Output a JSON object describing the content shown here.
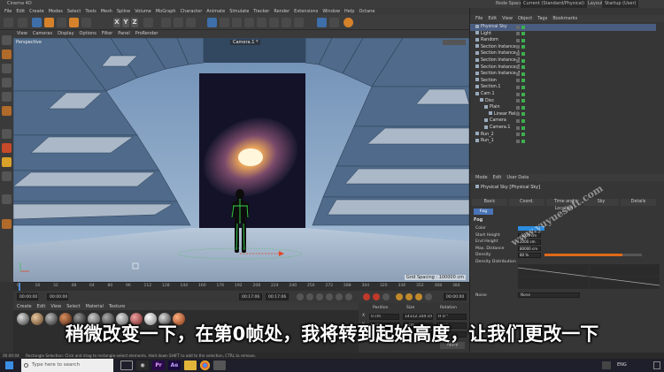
{
  "app": {
    "title": "Cinema 4D",
    "node_space_label": "Node Space:",
    "node_space_value": "Current (Standard/Physical)",
    "layout_label": "Layout:",
    "layout_value": "Startup (User)"
  },
  "menubar": [
    "File",
    "Edit",
    "Create",
    "Modes",
    "Select",
    "Tools",
    "Mesh",
    "Spline",
    "Volume",
    "MoGraph",
    "Character",
    "Animate",
    "Simulate",
    "Tracker",
    "Render",
    "Extensions",
    "Window",
    "Help",
    "Octane"
  ],
  "toolbar": {
    "axis_letters": [
      "X",
      "Y",
      "Z"
    ],
    "accent_blue": "#3e6fa8",
    "accent_orange": "#d6822b"
  },
  "viewport": {
    "menu": [
      "View",
      "Cameras",
      "Display",
      "Options",
      "Filter",
      "Panel",
      "ProRender"
    ],
    "projection_label": "Perspective",
    "camera_label": "Camera.1 *",
    "grid_spacing": "Grid Spacing : 100000 cm"
  },
  "timeline": {
    "ticks": [
      "0",
      "16",
      "32",
      "48",
      "64",
      "80",
      "96",
      "112",
      "128",
      "144",
      "160",
      "176",
      "192",
      "208",
      "224",
      "240",
      "256",
      "272",
      "288",
      "304",
      "320",
      "336",
      "352",
      "368",
      "384"
    ],
    "current_frame": "0 F",
    "start_field": "00:00:00",
    "min_field": "00:00:00",
    "end_field": "00:17:06",
    "max_field": "00:17:06",
    "right_field": "00:00:00"
  },
  "materials": {
    "menu": [
      "Create",
      "Edit",
      "View",
      "Select",
      "Material",
      "Texture"
    ]
  },
  "coordinates": {
    "headers": [
      "Position",
      "Size",
      "Rotation"
    ],
    "rows": [
      {
        "axis": "X",
        "pos": "0 cm",
        "size": "14312.104 cm",
        "rot": "H  0 °"
      },
      {
        "axis": "Y",
        "pos": "0 cm",
        "size": "0 cm",
        "rot": "P  0 °"
      },
      {
        "axis": "Z",
        "pos": "0 cm",
        "size": "0 cm",
        "rot": "B  0 °"
      }
    ],
    "apply_button": "Apply"
  },
  "object_manager": {
    "menu": [
      "File",
      "Edit",
      "View",
      "Object",
      "Tags",
      "Bookmarks"
    ],
    "objects": [
      {
        "name": "Physical Sky",
        "selected": true,
        "indent": 0
      },
      {
        "name": "Light",
        "selected": false,
        "indent": 0
      },
      {
        "name": "Random",
        "selected": false,
        "indent": 0
      },
      {
        "name": "Section Instance",
        "selected": false,
        "indent": 0
      },
      {
        "name": "Section Instance.1",
        "selected": false,
        "indent": 0
      },
      {
        "name": "Section Instance.2",
        "selected": false,
        "indent": 0
      },
      {
        "name": "Section Instance.3",
        "selected": false,
        "indent": 0
      },
      {
        "name": "Section Instance.4",
        "selected": false,
        "indent": 0
      },
      {
        "name": "Section",
        "selected": false,
        "indent": 0
      },
      {
        "name": "Section.1",
        "selected": false,
        "indent": 0
      },
      {
        "name": "Cam 1",
        "selected": false,
        "indent": 0
      },
      {
        "name": "Disc",
        "selected": false,
        "indent": 1
      },
      {
        "name": "Plain",
        "selected": false,
        "indent": 2
      },
      {
        "name": "Linear Field",
        "selected": false,
        "indent": 3
      },
      {
        "name": "Camera",
        "selected": false,
        "indent": 2
      },
      {
        "name": "Camera.1",
        "selected": false,
        "indent": 2
      },
      {
        "name": "Run_2",
        "selected": false,
        "indent": 0
      },
      {
        "name": "Run_1",
        "selected": false,
        "indent": 0
      }
    ]
  },
  "attribute_manager": {
    "menu": [
      "Mode",
      "Edit",
      "User Data"
    ],
    "object_title": "Physical Sky [Physical Sky]",
    "tabs": [
      "Basic",
      "Coord.",
      "Time and Location",
      "Sky",
      "Details"
    ],
    "active_subtab": "Fog",
    "section_title": "Fog",
    "fields": [
      {
        "label": "Color",
        "value": ""
      },
      {
        "label": "Start Height",
        "value": "-5000 cm"
      },
      {
        "label": "End Height",
        "value": "2000 cm"
      },
      {
        "label": "Max. Distance",
        "value": "80000 cm"
      },
      {
        "label": "Density",
        "value": "80 %"
      },
      {
        "label": "Density Distribution",
        "value": ""
      }
    ],
    "noise_label": "Noise",
    "noise_value": "None",
    "fog_color": "#2b8ce0",
    "density_marker_color": "#e06a1a"
  },
  "statusbar": {
    "time": "00:00:04",
    "message": "Rectangle Selection: Click and drag to rectangle-select elements. Hold down SHIFT to add to the selection, CTRL to remove."
  },
  "taskbar": {
    "search_placeholder": "Type here to search",
    "language": "ENG",
    "app_labels": [
      "Pr",
      "Ae"
    ]
  },
  "subtitle": "稍微改变一下，在第0帧处，我将转到起始高度，让我们更改一下",
  "watermark": "www.yuyuesoft.com"
}
